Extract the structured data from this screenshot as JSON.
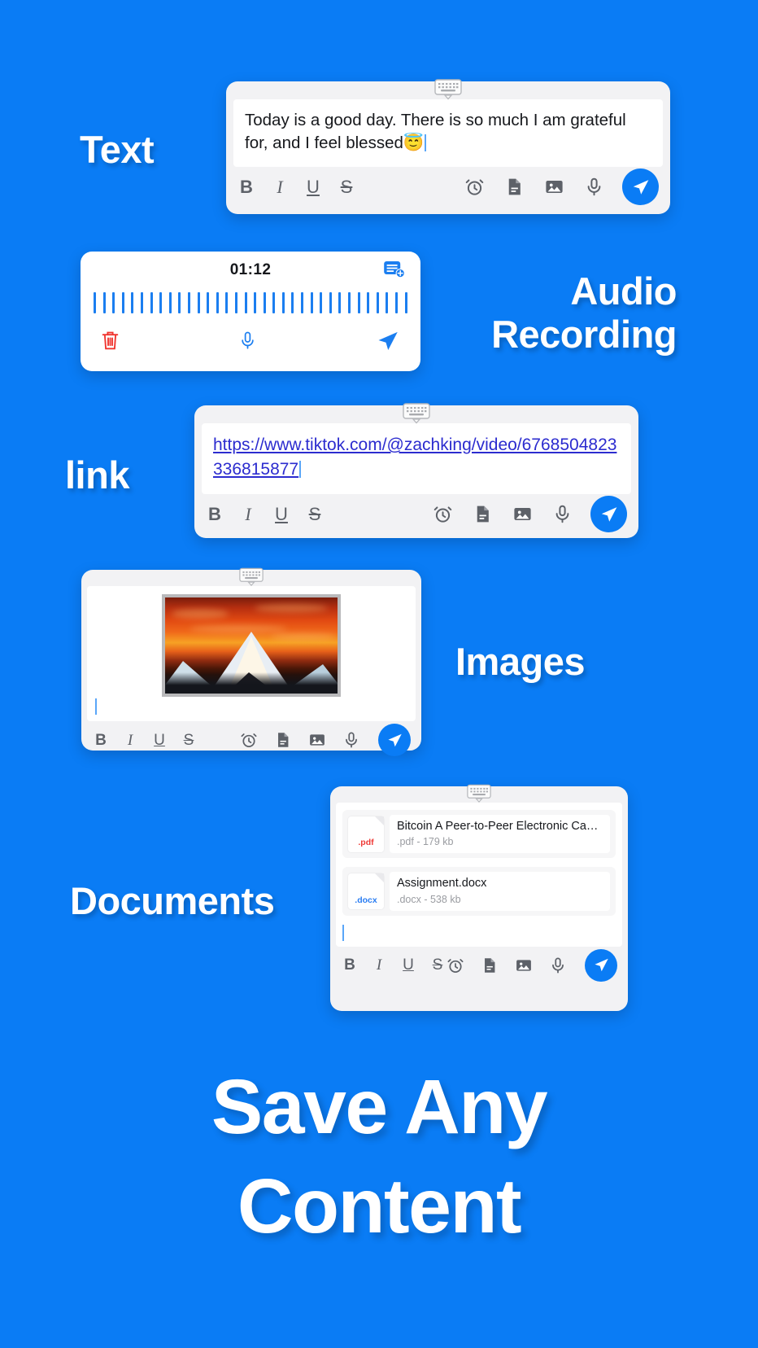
{
  "background_color": "#0a7cf5",
  "labels": {
    "text": "Text",
    "audio": "Audio\nRecording",
    "audio_line1": "Audio",
    "audio_line2": "Recording",
    "link": "link",
    "images": "Images",
    "documents": "Documents"
  },
  "headline": {
    "line1": "Save Any",
    "line2": "Content"
  },
  "toolbar": {
    "bold": "B",
    "italic": "I",
    "underline": "U",
    "strikethrough": "S",
    "icons": [
      "alarm-clock-icon",
      "document-icon",
      "image-icon",
      "microphone-icon"
    ],
    "send": "send-icon"
  },
  "cards": {
    "text": {
      "keyboard_handle": "keyboard-icon",
      "body": "Today is a good day. There is so much I am grateful for, and I feel blessed😇"
    },
    "audio": {
      "timer": "01:12",
      "new_note_icon": "new-note-icon",
      "waveform_bars": 34,
      "waveform_color": "#1b7ef0",
      "delete_icon": "trash-icon",
      "mic_icon": "microphone-icon",
      "send_icon": "send-icon"
    },
    "link": {
      "keyboard_handle": "keyboard-icon",
      "url": "https://www.tiktok.com/@zachking/video/6768504823336815877",
      "link_color": "#2c2ccf"
    },
    "images": {
      "keyboard_handle": "keyboard-icon",
      "photo_alt": "sunset-mountain-photo"
    },
    "documents": {
      "keyboard_handle": "keyboard-icon",
      "files": [
        {
          "ext_badge": ".pdf",
          "name": "Bitcoin A Peer-to-Peer Electronic Cash S...",
          "sub": ".pdf - 179 kb",
          "color": "#ef3b37"
        },
        {
          "ext_badge": ".docx",
          "name": "Assignment.docx",
          "sub": ".docx - 538 kb",
          "color": "#2a7df2"
        }
      ]
    }
  }
}
